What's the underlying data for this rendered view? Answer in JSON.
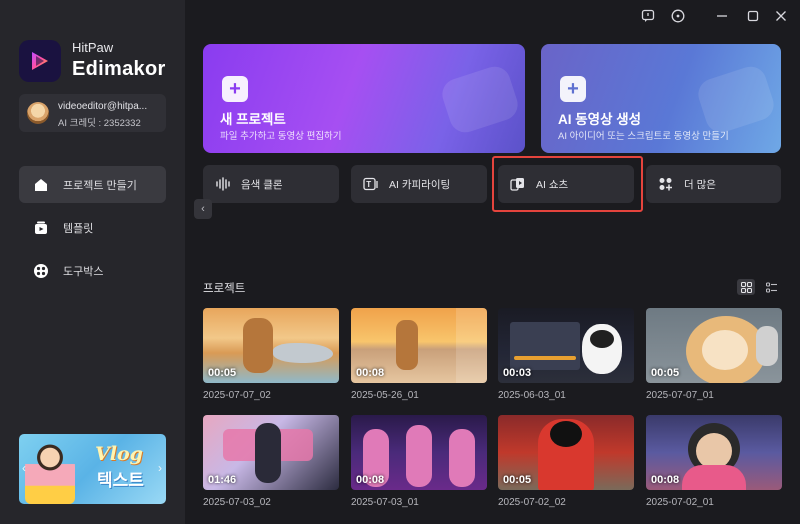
{
  "app": {
    "name_line1": "HitPaw",
    "name_line2": "Edimakor"
  },
  "user": {
    "email": "videoeditor@hitpa...",
    "credit": "AI 크레딧 : 2352332"
  },
  "sidebar": {
    "items": [
      {
        "label": "프로젝트 만들기",
        "icon": "house-icon"
      },
      {
        "label": "템플릿",
        "icon": "template-icon"
      },
      {
        "label": "도구박스",
        "icon": "toolbox-icon"
      }
    ],
    "banner": {
      "vlog": "Vlog",
      "text": "텍스트"
    }
  },
  "titlebar": {
    "icons": [
      "feedback-icon",
      "info-icon",
      "minimize-icon",
      "maximize-icon",
      "close-icon"
    ]
  },
  "cards": {
    "new_project": {
      "title": "새 프로젝트",
      "subtitle": "파일 추가하고 동영상 편집하기"
    },
    "ai_video": {
      "title": "AI 동영상 생성",
      "subtitle": "AI 아이디어 또는 스크립트로 동영상 만들기"
    }
  },
  "features": [
    {
      "label": "음색 클론",
      "icon": "waveform-icon"
    },
    {
      "label": "AI 카피라이팅",
      "icon": "ai-copywriting-icon"
    },
    {
      "label": "AI 쇼츠",
      "icon": "ai-shorts-icon"
    },
    {
      "label": "더 많은",
      "icon": "more-apps-icon"
    }
  ],
  "projects_section": {
    "title": "프로젝트"
  },
  "projects": [
    {
      "duration": "00:05",
      "name": "2025-07-07_02"
    },
    {
      "duration": "00:08",
      "name": "2025-05-26_01"
    },
    {
      "duration": "00:03",
      "name": "2025-06-03_01"
    },
    {
      "duration": "00:05",
      "name": "2025-07-07_01"
    },
    {
      "duration": "01:46",
      "name": "2025-07-03_02"
    },
    {
      "duration": "00:08",
      "name": "2025-07-03_01"
    },
    {
      "duration": "00:05",
      "name": "2025-07-02_02"
    },
    {
      "duration": "00:08",
      "name": "2025-07-02_01"
    }
  ],
  "colors": {
    "accent_purple": "#8a3cf0",
    "highlight_red": "#e5443d",
    "sidebar_bg": "#26262b",
    "main_bg": "#1b1b1f"
  }
}
